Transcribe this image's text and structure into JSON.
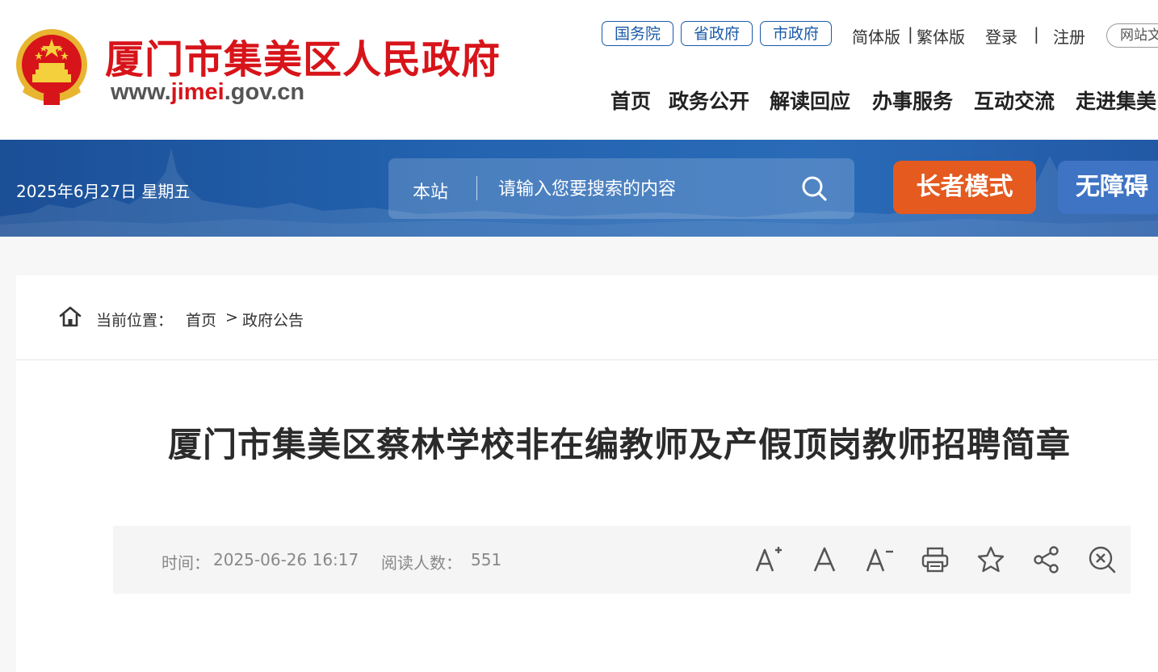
{
  "header": {
    "site_name": "厦门市集美区人民政府",
    "url_prefix": "www.",
    "url_highlight": "jimei",
    "url_suffix": ".gov.cn",
    "gov_links": [
      "国务院",
      "省政府",
      "市政府"
    ],
    "lang_simplified": "简体版",
    "lang_sep": "|",
    "lang_traditional": "繁体版",
    "login": "登录",
    "auth_sep": "|",
    "register": "注册",
    "site_search": "网站文",
    "nav": [
      "首页",
      "政务公开",
      "解读回应",
      "办事服务",
      "互动交流",
      "走进集美"
    ]
  },
  "banner": {
    "date": "2025年6月27日 星期五",
    "search_scope": "本站",
    "search_placeholder": "请输入您要搜索的内容",
    "elder_mode": "长者模式",
    "accessibility": "无障碍"
  },
  "breadcrumb": {
    "label": "当前位置：",
    "home": "首页",
    "separator": ">",
    "current": "政府公告"
  },
  "article": {
    "title": "厦门市集美区蔡林学校非在编教师及产假顶岗教师招聘简章",
    "time_label": "时间：",
    "time": "2025-06-26 16:17",
    "views_label": "阅读人数：",
    "views": "551"
  },
  "tools": [
    "font-increase-icon",
    "font-reset-icon",
    "font-decrease-icon",
    "print-icon",
    "favorite-icon",
    "share-icon",
    "close-icon"
  ],
  "colors": {
    "brand_red": "#d7141a",
    "nav_blue": "#1a5aa8",
    "banner_blue": "#2363b0",
    "elder_orange": "#e45a1f"
  }
}
